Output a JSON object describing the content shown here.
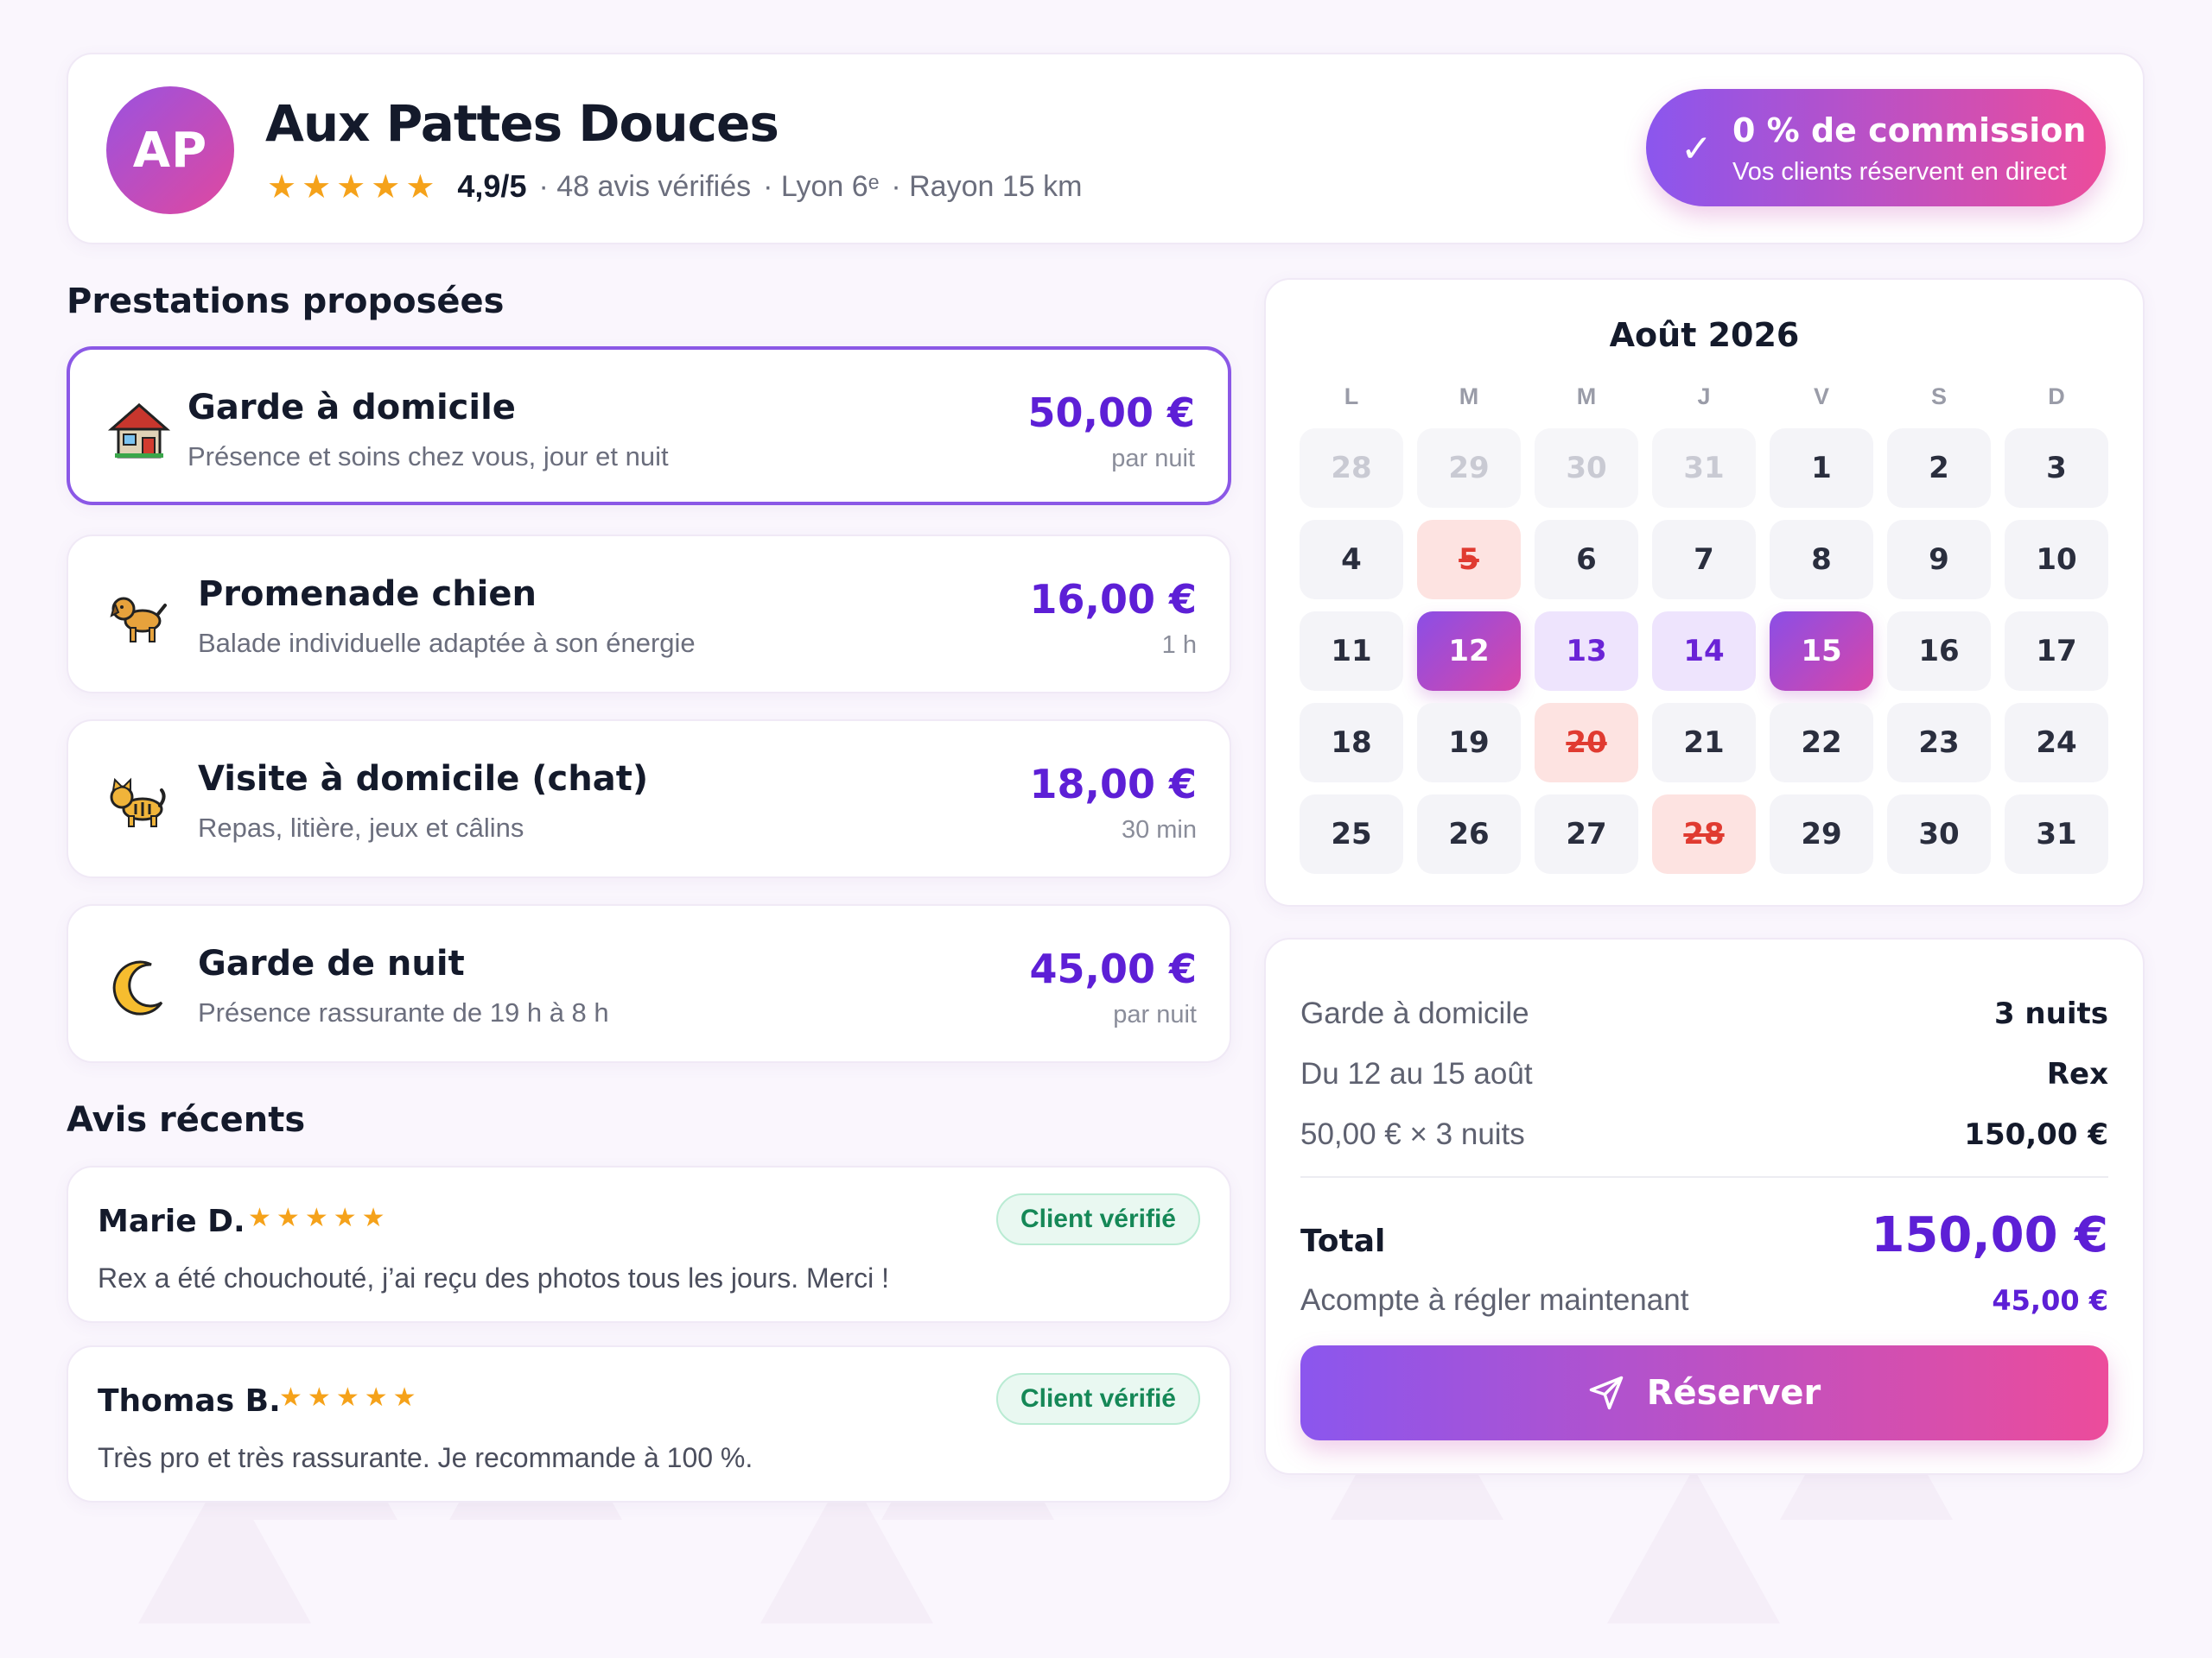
{
  "header": {
    "initials": "AP",
    "name": "Aux Pattes Douces",
    "rating": "4,9/5",
    "reviews": "· 48 avis vérifiés",
    "location": "· Lyon 6ᵉ",
    "radius": "· Rayon 15 km",
    "commission_title": "0 % de commission",
    "commission_sub": "Vos clients réservent en direct",
    "star_count": 5
  },
  "services": {
    "title": "Prestations proposées",
    "items": [
      {
        "icon": "house-icon",
        "name": "Garde à domicile",
        "desc": "Présence et soins chez vous, jour et nuit",
        "price": "50,00 €",
        "unit": "par nuit",
        "selected": true
      },
      {
        "icon": "dog-icon",
        "name": "Promenade chien",
        "desc": "Balade individuelle adaptée à son énergie",
        "price": "16,00 €",
        "unit": "1 h",
        "selected": false
      },
      {
        "icon": "cat-icon",
        "name": "Visite à domicile (chat)",
        "desc": "Repas, litière, jeux et câlins",
        "price": "18,00 €",
        "unit": "30 min",
        "selected": false
      },
      {
        "icon": "moon-icon",
        "name": "Garde de nuit",
        "desc": "Présence rassurante de 19 h à 8 h",
        "price": "45,00 €",
        "unit": "par nuit",
        "selected": false
      }
    ]
  },
  "reviews": {
    "title": "Avis récents",
    "items": [
      {
        "author": "Marie D.",
        "stars": 5,
        "badge": "Client vérifié",
        "text": "Rex a été chouchouté, j’ai reçu des photos tous les jours. Merci !"
      },
      {
        "author": "Thomas B.",
        "stars": 5,
        "badge": "Client vérifié",
        "text": "Très pro et très rassurante. Je recommande à 100 %."
      }
    ]
  },
  "calendar": {
    "title": "Août 2026",
    "weekdays": [
      "L",
      "M",
      "M",
      "J",
      "V",
      "S",
      "D"
    ],
    "days": [
      {
        "n": "28",
        "s": "out"
      },
      {
        "n": "29",
        "s": "out"
      },
      {
        "n": "30",
        "s": "out"
      },
      {
        "n": "31",
        "s": "out"
      },
      {
        "n": "1",
        "s": ""
      },
      {
        "n": "2",
        "s": ""
      },
      {
        "n": "3",
        "s": ""
      },
      {
        "n": "4",
        "s": ""
      },
      {
        "n": "5",
        "s": "blocked"
      },
      {
        "n": "6",
        "s": ""
      },
      {
        "n": "7",
        "s": ""
      },
      {
        "n": "8",
        "s": ""
      },
      {
        "n": "9",
        "s": ""
      },
      {
        "n": "10",
        "s": ""
      },
      {
        "n": "11",
        "s": ""
      },
      {
        "n": "12",
        "s": "edge"
      },
      {
        "n": "13",
        "s": "range"
      },
      {
        "n": "14",
        "s": "range"
      },
      {
        "n": "15",
        "s": "edge"
      },
      {
        "n": "16",
        "s": ""
      },
      {
        "n": "17",
        "s": ""
      },
      {
        "n": "18",
        "s": ""
      },
      {
        "n": "19",
        "s": ""
      },
      {
        "n": "20",
        "s": "blocked"
      },
      {
        "n": "21",
        "s": ""
      },
      {
        "n": "22",
        "s": ""
      },
      {
        "n": "23",
        "s": ""
      },
      {
        "n": "24",
        "s": ""
      },
      {
        "n": "25",
        "s": ""
      },
      {
        "n": "26",
        "s": ""
      },
      {
        "n": "27",
        "s": ""
      },
      {
        "n": "28",
        "s": "blocked"
      },
      {
        "n": "29",
        "s": ""
      },
      {
        "n": "30",
        "s": ""
      },
      {
        "n": "31",
        "s": ""
      }
    ]
  },
  "summary": {
    "service_label": "Garde à domicile",
    "service_value": "3 nuits",
    "dates_label": "Du 12 au 15 août",
    "dates_value": "Rex",
    "calc_label": "50,00 € × 3 nuits",
    "calc_value": "150,00 €",
    "total_label": "Total",
    "total_value": "150,00 €",
    "deposit_label": "Acompte à régler maintenant",
    "deposit_value": "45,00 €",
    "book_label": "Réserver"
  },
  "colors": {
    "accent": "#5d1fd6",
    "gradient_start": "#8b56ee",
    "gradient_end": "#ec4c9b",
    "star": "#f5a21a",
    "blocked": "#e03b31"
  }
}
